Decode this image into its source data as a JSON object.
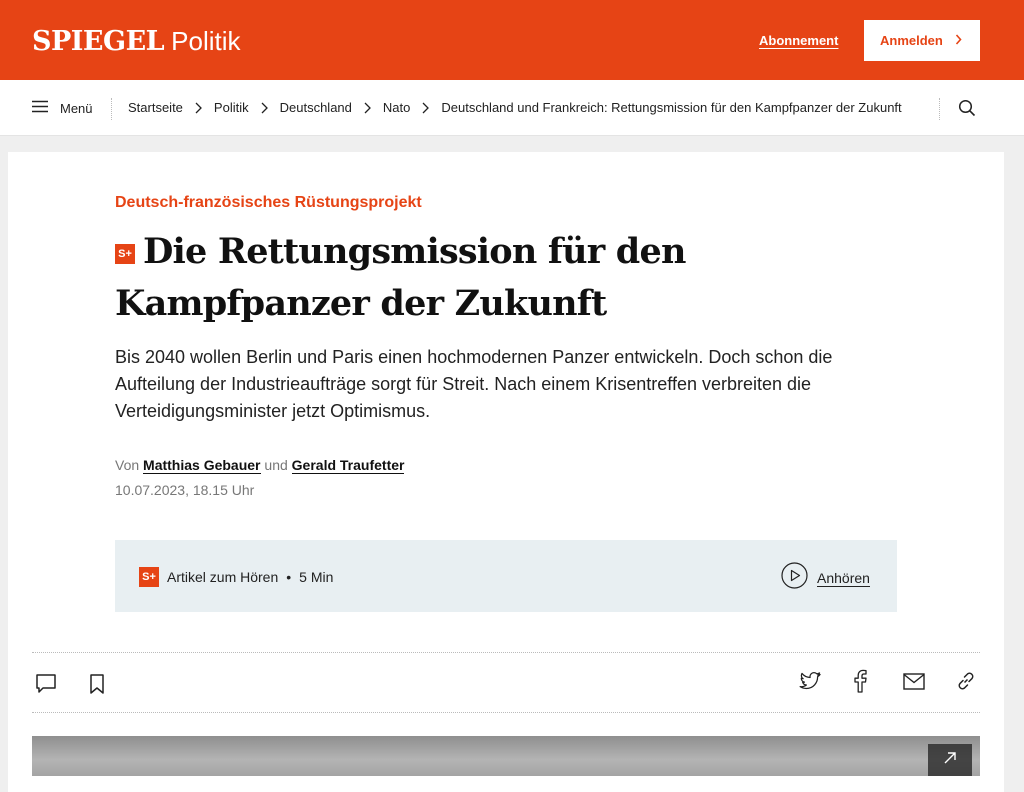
{
  "header": {
    "logo": "SPIEGEL",
    "section": "Politik",
    "abo_label": "Abonnement",
    "login_label": "Anmelden"
  },
  "nav": {
    "menu_label": "Menü",
    "breadcrumbs": [
      "Startseite",
      "Politik",
      "Deutschland",
      "Nato",
      "Deutschland und Frankreich: Rettungsmission für den Kampfpanzer der Zukunft"
    ]
  },
  "article": {
    "kicker": "Deutsch-französisches Rüstungsprojekt",
    "badge": "S+",
    "headline": "Die Rettungsmission für den Kampfpanzer der Zukunft",
    "intro": "Bis 2040 wollen Berlin und Paris einen hochmodernen Panzer entwickeln. Doch schon die Aufteilung der Industrieaufträge sorgt für Streit. Nach einem Krisentreffen verbreiten die Verteidigungsminister jetzt Optimismus.",
    "byline_prefix": "Von",
    "authors": [
      "Matthias Gebauer",
      "Gerald Traufetter"
    ],
    "byline_and": "und",
    "date": "10.07.2023, 18.15 Uhr"
  },
  "audio": {
    "badge": "S+",
    "label": "Artikel zum Hören",
    "separator": "•",
    "duration": "5 Min",
    "play_label": "Anhören"
  },
  "share": {
    "icons": [
      "comment-icon",
      "bookmark-icon",
      "twitter-icon",
      "facebook-icon",
      "mail-icon",
      "link-icon"
    ]
  },
  "colors": {
    "brand": "#e64415",
    "audio_bg": "#e8eff2"
  }
}
